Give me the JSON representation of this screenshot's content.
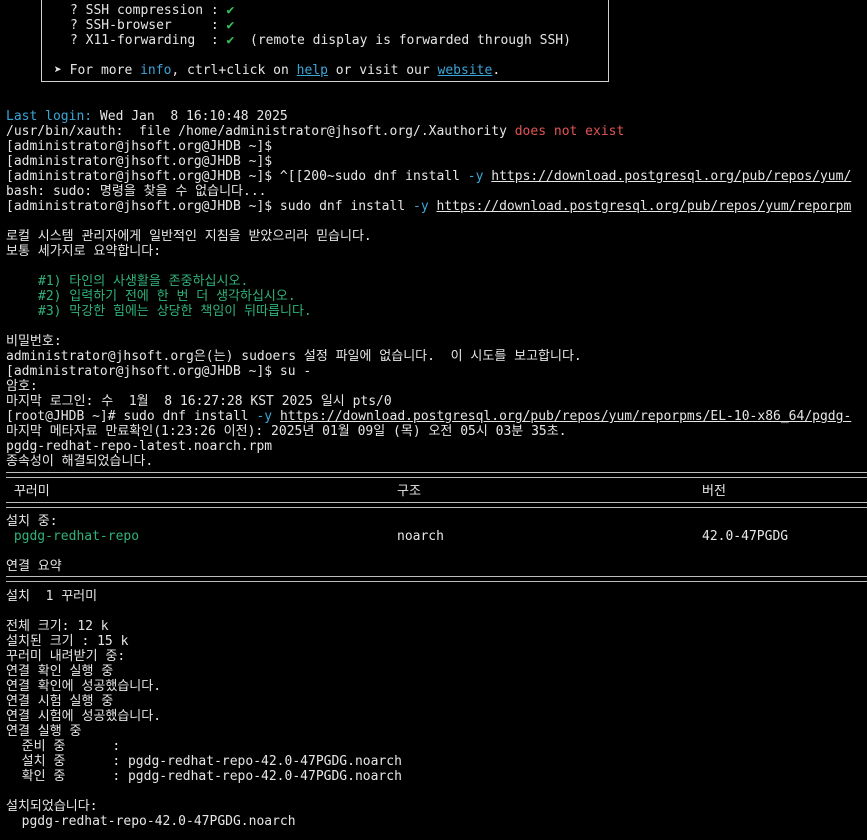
{
  "info_box": {
    "ssh_compression": "? SSH compression : ",
    "ssh_browser": "? SSH-browser     : ",
    "x11_forwarding": "? X11-forwarding  : ",
    "check": "✔",
    "x11_note": "  (remote display is forwarded through SSH)",
    "more_prefix": "➤ For more ",
    "more_info": "info",
    "more_mid": ", ctrl+click on ",
    "more_help": "help",
    "more_or": " or visit our ",
    "more_website": "website",
    "more_end": "."
  },
  "lines": {
    "last_login_label": "Last login:",
    "last_login_value": " Wed Jan  8 16:10:48 2025",
    "xauth_msg": "/usr/bin/xauth:  file /home/administrator@jhsoft.org/.Xauthority ",
    "xauth_err": "does not exist",
    "prompt": "[administrator@jhsoft.org@JHDB ~]$",
    "prompt_paste": "[administrator@jhsoft.org@JHDB ~]$ ^[[200~sudo dnf install ",
    "flag_y": "-y",
    "url_paste": "https://download.postgresql.org/pub/repos/yum/",
    "bash_err": "bash: sudo: 명령을 찾을 수 없습니다...",
    "prompt_sudo": "[administrator@jhsoft.org@JHDB ~]$ sudo dnf install ",
    "url_sudo": "https://download.postgresql.org/pub/repos/yum/reporpm",
    "lecture1": "로컬 시스템 관리자에게 일반적인 지침을 받았으리라 믿습니다.",
    "lecture2": "보통 세가지로 요약합니다:",
    "rule1": "#1) 타인의 사생활을 존중하십시오.",
    "rule2": "#2) 입력하기 전에 한 번 더 생각하십시오.",
    "rule3": "#3) 막강한 힘에는 상당한 책임이 뒤따릅니다.",
    "password": "비밀번호:",
    "not_sudoers": "administrator@jhsoft.org은(는) sudoers 설정 파일에 없습니다.  이 시도를 보고합니다.",
    "prompt_su": "[administrator@jhsoft.org@JHDB ~]$ su -",
    "password2": "암호:",
    "last_login_ko": "마지막 로그인: 수  1월  8 16:27:28 KST 2025 일시 pts/0",
    "root_prompt": "[root@JHDB ~]# sudo dnf install ",
    "url_root": "https://download.postgresql.org/pub/repos/yum/reporpms/EL-10-x86_64/pgdg-",
    "metadata": "마지막 메타자료 만료확인(1:23:26 이전): 2025년 01월 09일 (목) 오전 05시 03분 35초.",
    "rpm_name": "pgdg-redhat-repo-latest.noarch.rpm",
    "deps_resolved": "종속성이 해결되었습니다.",
    "hdr_package": " 꾸러미",
    "hdr_arch": "구조",
    "hdr_version": "버전",
    "installing": "설치 중:",
    "pkg_name": " pgdg-redhat-repo",
    "pkg_arch": "noarch",
    "pkg_version": "42.0-47PGDG",
    "txn_summary": "연결 요약",
    "install_count": "설치  1 꾸러미",
    "total_size": "전체 크기: 12 k",
    "installed_size": "설치된 크기 : 15 k",
    "downloading": "꾸러미 내려받기 중:",
    "check_run": "연결 확인 실행 중",
    "check_ok": "연결 확인에 성공했습니다.",
    "test_run": "연결 시험 실행 중",
    "test_ok": "연결 시험에 성공했습니다.",
    "txn_run": "연결 실행 중",
    "preparing": "  준비 중      :",
    "installing_pkg": "  설치 중      : pgdg-redhat-repo-42.0-47PGDG.noarch",
    "verifying_pkg": "  확인 중      : pgdg-redhat-repo-42.0-47PGDG.noarch",
    "installed": "설치되었습니다:",
    "installed_pkg": "  pgdg-redhat-repo-42.0-47PGDG.noarch"
  }
}
